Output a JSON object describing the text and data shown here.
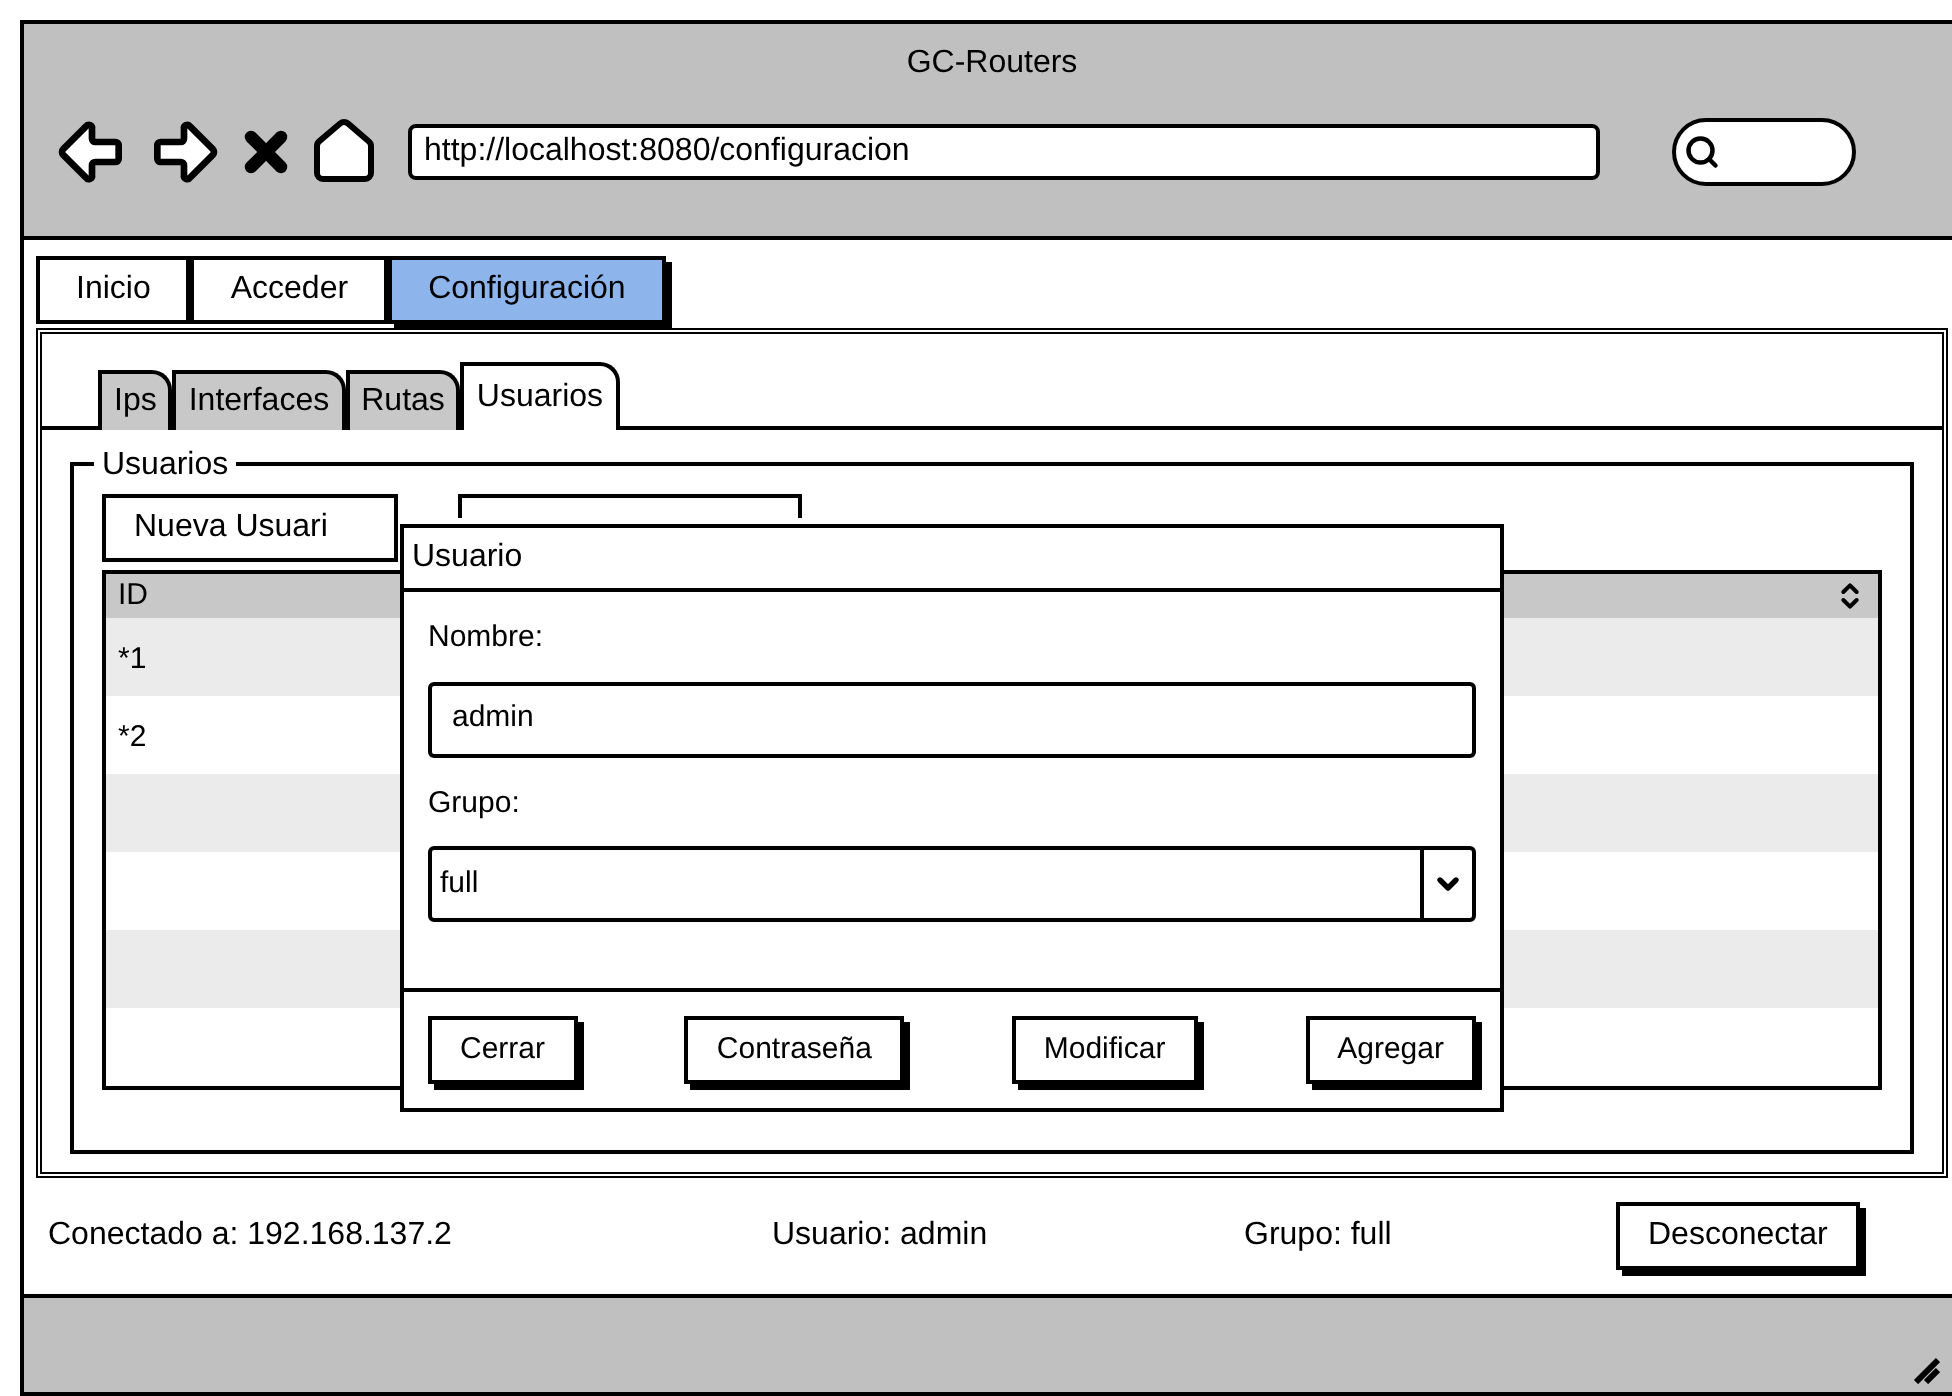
{
  "window": {
    "title": "GC-Routers"
  },
  "address_bar": {
    "value": "http://localhost:8080/configuracion"
  },
  "nav_tabs": [
    {
      "label": "Inicio",
      "selected": false
    },
    {
      "label": "Acceder",
      "selected": false
    },
    {
      "label": "Configuración",
      "selected": true
    }
  ],
  "sub_tabs": [
    {
      "label": "Ips",
      "selected": false
    },
    {
      "label": "Interfaces",
      "selected": false
    },
    {
      "label": "Rutas",
      "selected": false
    },
    {
      "label": "Usuarios",
      "selected": true
    }
  ],
  "group": {
    "title": "Usuarios",
    "button": "Nueva Usuari"
  },
  "table": {
    "columns": [
      "ID"
    ],
    "rows": [
      [
        "*1"
      ],
      [
        "*2"
      ]
    ]
  },
  "dialog": {
    "title": "Usuario",
    "fields": [
      {
        "label": "Nombre:",
        "kind": "text",
        "value": "admin"
      },
      {
        "label": "Grupo:",
        "kind": "select",
        "value": "full"
      }
    ],
    "buttons": [
      "Cerrar",
      "Contraseña",
      "Modificar",
      "Agregar"
    ]
  },
  "status_bar": {
    "items": [
      "Conectado a: 192.168.137.2",
      "Usuario: admin",
      "Grupo: full"
    ],
    "button": "Desconectar"
  }
}
